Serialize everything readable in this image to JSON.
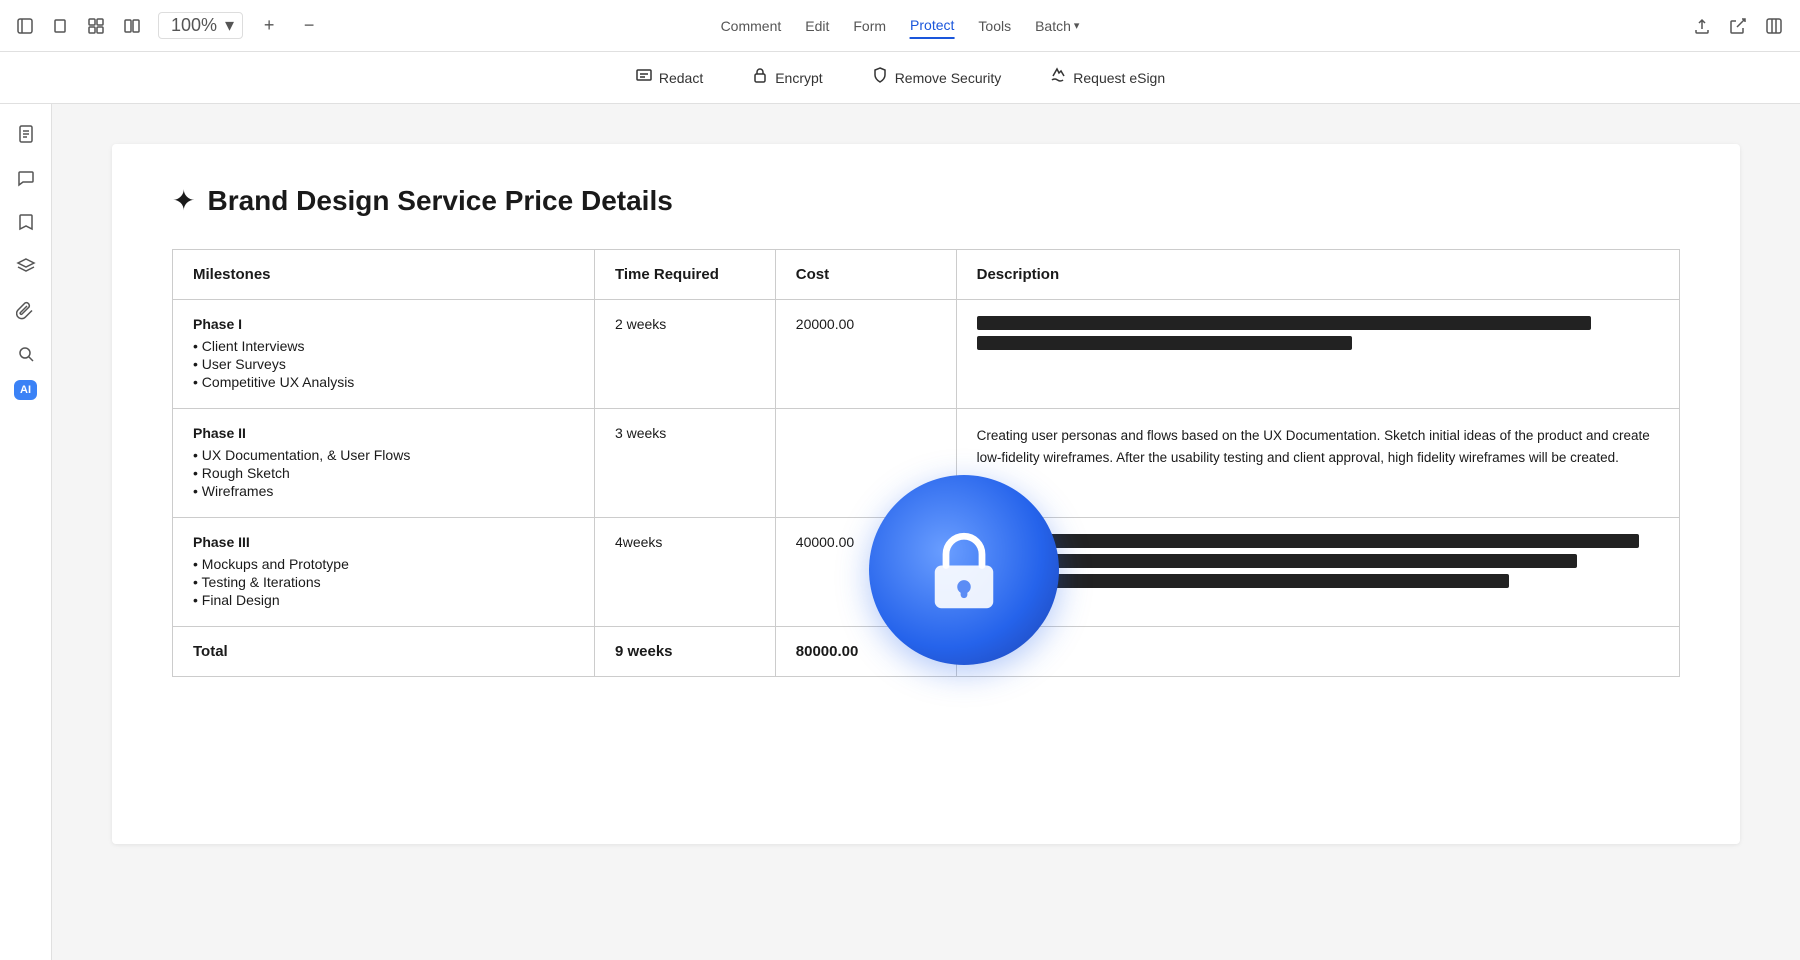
{
  "topnav": {
    "zoom": "100%",
    "menus": [
      {
        "id": "comment",
        "label": "Comment",
        "active": false
      },
      {
        "id": "edit",
        "label": "Edit",
        "active": false
      },
      {
        "id": "form",
        "label": "Form",
        "active": false
      },
      {
        "id": "protect",
        "label": "Protect",
        "active": true
      },
      {
        "id": "tools",
        "label": "Tools",
        "active": false
      },
      {
        "id": "batch",
        "label": "Batch",
        "active": false,
        "hasArrow": true
      }
    ]
  },
  "subtoolbar": {
    "buttons": [
      {
        "id": "redact",
        "label": "Redact",
        "icon": "redact"
      },
      {
        "id": "encrypt",
        "label": "Encrypt",
        "icon": "lock"
      },
      {
        "id": "remove-security",
        "label": "Remove Security",
        "icon": "shield"
      },
      {
        "id": "request-esign",
        "label": "Request eSign",
        "icon": "esign"
      }
    ]
  },
  "sidebar": {
    "icons": [
      {
        "id": "page",
        "icon": "page",
        "active": false
      },
      {
        "id": "comment",
        "icon": "comment",
        "active": false
      },
      {
        "id": "bookmark",
        "icon": "bookmark",
        "active": false
      },
      {
        "id": "layers",
        "icon": "layers",
        "active": false
      },
      {
        "id": "attachment",
        "icon": "attachment",
        "active": false
      },
      {
        "id": "search",
        "icon": "search",
        "active": false
      },
      {
        "id": "ai",
        "label": "AI",
        "active": false
      }
    ]
  },
  "document": {
    "title": "Brand Design Service Price Details",
    "table": {
      "headers": [
        "Milestones",
        "Time Required",
        "Cost",
        "Description"
      ],
      "rows": [
        {
          "phase": "Phase I",
          "items": [
            "Client Interviews",
            "User Surveys",
            "Competitive UX Analysis"
          ],
          "time": "2 weeks",
          "cost": "20000.00",
          "description": "redacted",
          "redacted_bars": [
            {
              "width": "90%"
            },
            {
              "width": "55%"
            }
          ]
        },
        {
          "phase": "Phase II",
          "items": [
            "UX Documentation, & User Flows",
            "Rough Sketch",
            "Wireframes"
          ],
          "time": "3 weeks",
          "cost": "",
          "description": "Creating user personas and flows based on the UX Documentation. Sketch initial ideas of the product and create low-fidelity wireframes. After the usability testing and client approval, high fidelity wireframes will be created.",
          "redacted_bars": []
        },
        {
          "phase": "Phase III",
          "items": [
            "Mockups and Prototype",
            "Testing & Iterations",
            "Final Design"
          ],
          "time": "4weeks",
          "cost": "40000.00",
          "description": "redacted",
          "redacted_bars": [
            {
              "width": "97%"
            },
            {
              "width": "88%"
            },
            {
              "width": "78%"
            }
          ]
        }
      ],
      "total": {
        "label": "Total",
        "time": "9 weeks",
        "cost": "80000.00"
      }
    }
  }
}
